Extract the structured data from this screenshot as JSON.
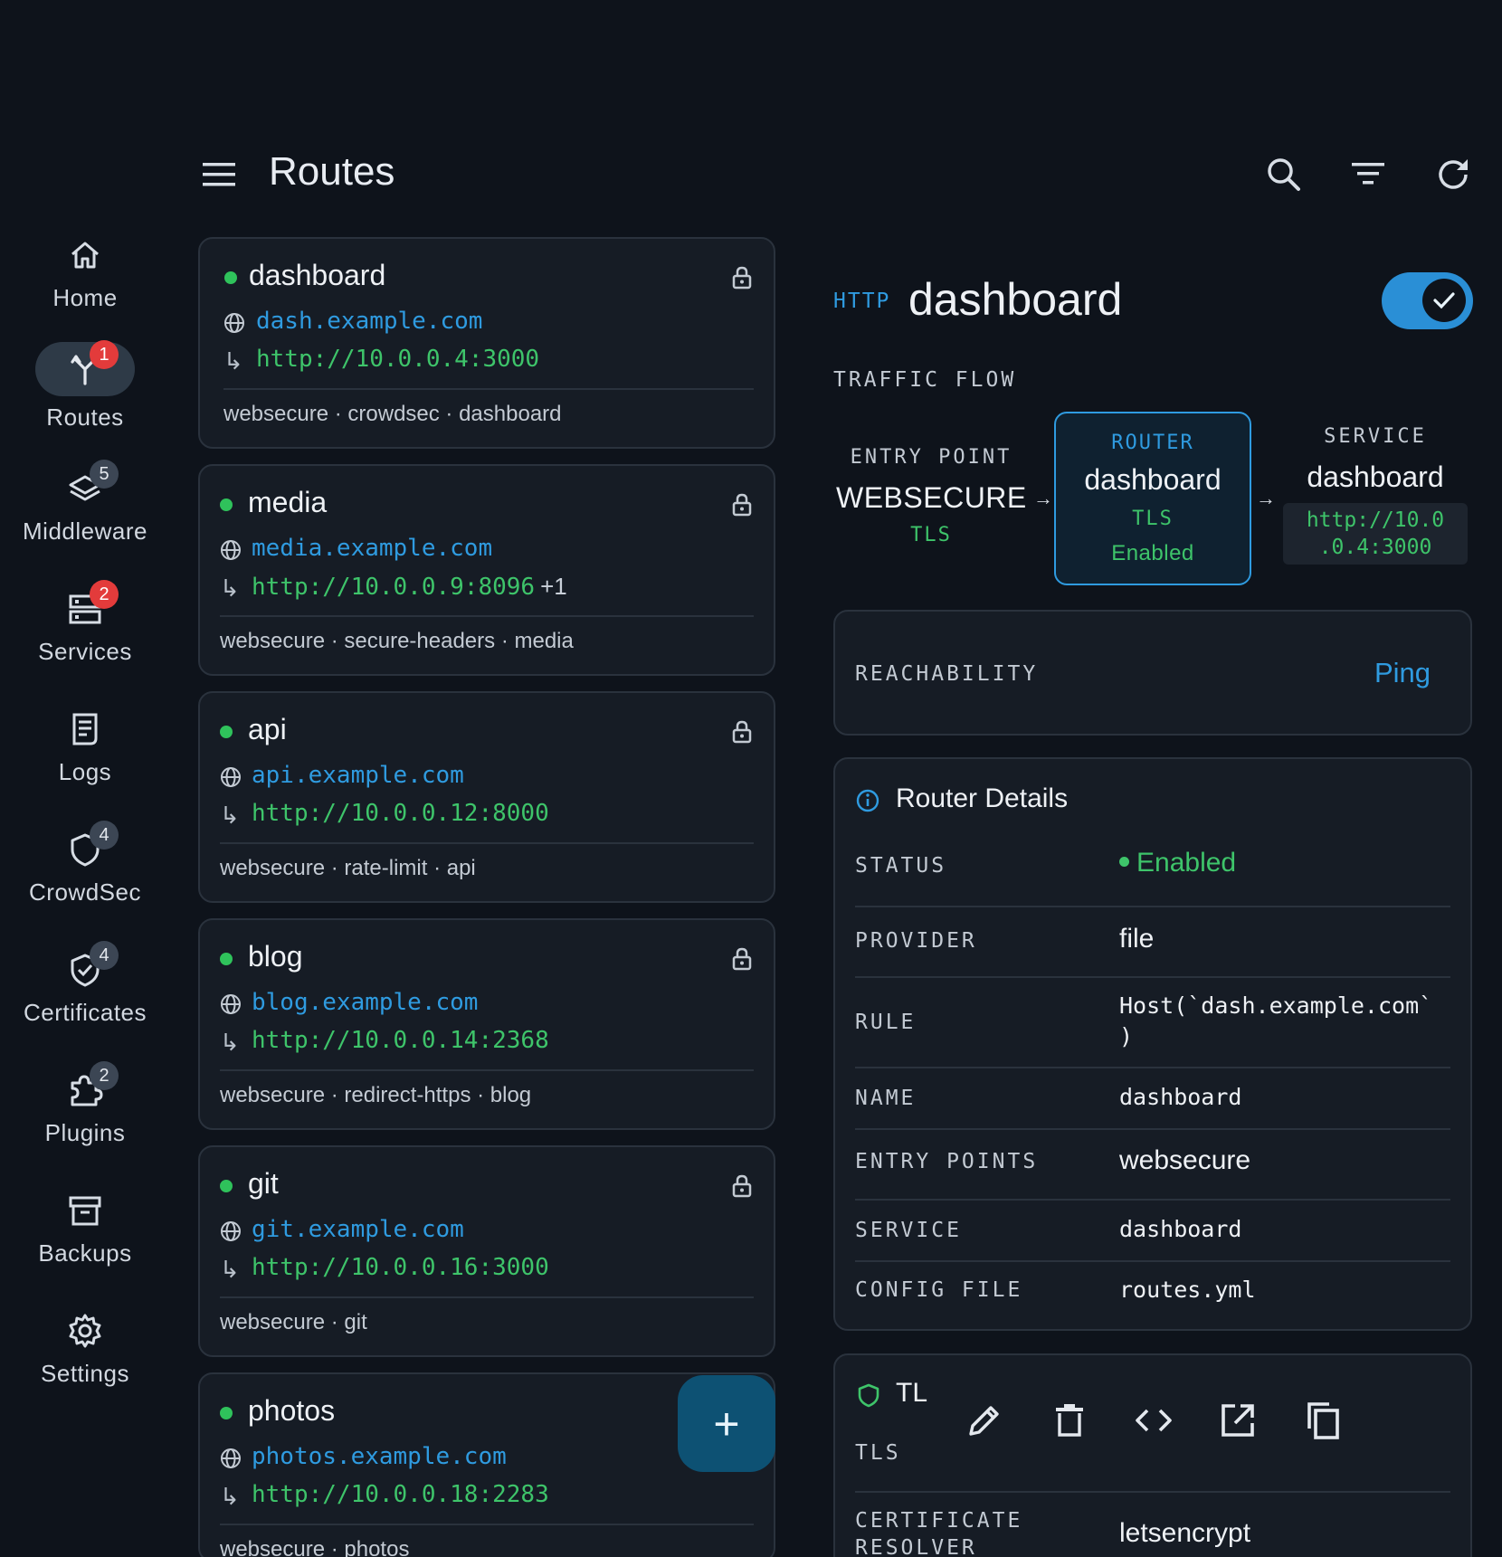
{
  "colors": {
    "background": "#0e131b",
    "accent": "#2f9be0",
    "success": "#3ec46a",
    "badge_red": "#e33b3b",
    "fab": "#0d5173"
  },
  "topbar": {
    "title": "Routes",
    "icons": [
      "menu-icon",
      "search-icon",
      "filter-icon",
      "refresh-icon"
    ]
  },
  "rail": {
    "items": [
      {
        "label": "Home",
        "icon": "home-icon",
        "badge": ""
      },
      {
        "label": "Routes",
        "icon": "routes-icon",
        "badge": "1",
        "active": true
      },
      {
        "label": "Middleware",
        "icon": "layers-icon",
        "badge": "5"
      },
      {
        "label": "Services",
        "icon": "server-icon",
        "badge": "2"
      },
      {
        "label": "Logs",
        "icon": "logs-icon",
        "badge": ""
      },
      {
        "label": "CrowdSec",
        "icon": "shield-icon",
        "badge": "4"
      },
      {
        "label": "Certificates",
        "icon": "certificate-icon",
        "badge": "4"
      },
      {
        "label": "Plugins",
        "icon": "puzzle-icon",
        "badge": "2"
      },
      {
        "label": "Backups",
        "icon": "archive-icon",
        "badge": ""
      },
      {
        "label": "Settings",
        "icon": "gear-icon",
        "badge": ""
      }
    ]
  },
  "routes": [
    {
      "name": "dashboard",
      "host": "dash.example.com",
      "target": "http://10.0.0.4:3000",
      "extra": "",
      "middlewares": "websecure · crowdsec · dashboard"
    },
    {
      "name": "media",
      "host": "media.example.com",
      "target": "http://10.0.0.9:8096",
      "extra": "+1",
      "middlewares": "websecure · secure-headers · media"
    },
    {
      "name": "api",
      "host": "api.example.com",
      "target": "http://10.0.0.12:8000",
      "extra": "",
      "middlewares": "websecure · rate-limit · api"
    },
    {
      "name": "blog",
      "host": "blog.example.com",
      "target": "http://10.0.0.14:2368",
      "extra": "",
      "middlewares": "websecure · redirect-https · blog"
    },
    {
      "name": "git",
      "host": "git.example.com",
      "target": "http://10.0.0.16:3000",
      "extra": "",
      "middlewares": "websecure · git"
    },
    {
      "name": "photos",
      "host": "photos.example.com",
      "target": "http://10.0.0.18:2283",
      "extra": "",
      "middlewares": "websecure · photos"
    }
  ],
  "fab": {
    "label": "+"
  },
  "detail": {
    "protocol": "HTTP",
    "name": "dashboard",
    "enabled": true,
    "traffic_flow_label": "TRAFFIC FLOW",
    "flow": {
      "entry_label": "ENTRY POINT",
      "entry_value": "WEBSECURE",
      "entry_tls": "TLS",
      "router_label": "ROUTER",
      "router_value": "dashboard",
      "router_tls": "TLS",
      "router_tls_state": "Enabled",
      "service_label": "SERVICE",
      "service_value": "dashboard",
      "service_url_1": "http://10.0",
      "service_url_2": ".0.4:3000"
    },
    "reachability": {
      "label": "REACHABILITY",
      "action": "Ping"
    },
    "router_details": {
      "title": "Router Details",
      "status_label": "STATUS",
      "status_value": "Enabled",
      "provider_label": "PROVIDER",
      "provider_value": "file",
      "rule_label": "RULE",
      "rule_line1": "Host(`dash.example.com`",
      "rule_line2": ")",
      "name_label": "NAME",
      "name_value": "dashboard",
      "entry_points_label": "ENTRY POINTS",
      "entry_points_value": "websecure",
      "service_label": "SERVICE",
      "service_value": "dashboard",
      "config_label": "CONFIG FILE",
      "config_value": "routes.yml"
    },
    "tls": {
      "title": "TL",
      "tls_label": "TLS",
      "resolver_label_1": "CERTIFICATE",
      "resolver_label_2": "RESOLVER",
      "resolver_value": "letsencrypt"
    },
    "actions": [
      "edit-icon",
      "delete-icon",
      "code-icon",
      "open-external-icon",
      "copy-icon"
    ]
  }
}
